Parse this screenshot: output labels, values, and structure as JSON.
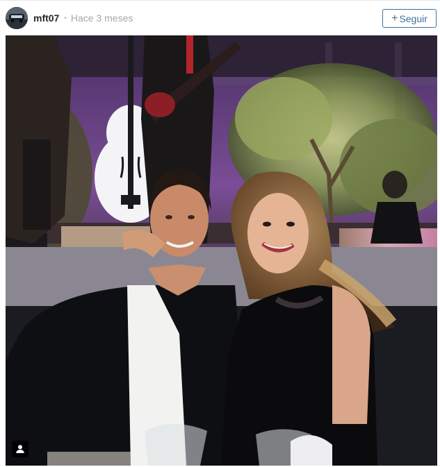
{
  "post": {
    "username": "mft07",
    "separator": "•",
    "timestamp": "Hace 3 meses",
    "follow_label": "Seguir",
    "follow_icon": "plus-icon"
  },
  "photo": {
    "description_icon": "user-tag-icon"
  },
  "colors": {
    "accent": "#3f729b",
    "username": "#262626",
    "muted": "#a5a7aa"
  }
}
